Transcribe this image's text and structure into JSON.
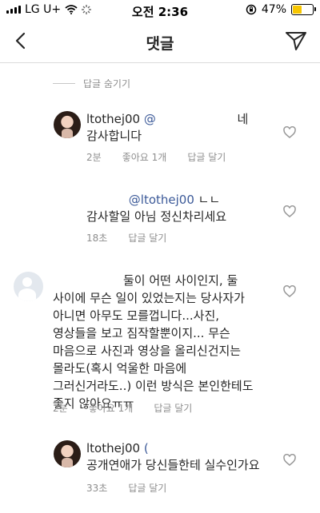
{
  "status": {
    "carrier": "LG U+",
    "time": "오전 2:36",
    "battery": "47%"
  },
  "header": {
    "title": "댓글"
  },
  "hide_replies_label": "답글 숨기기",
  "comments": [
    {
      "username": "ltothej00",
      "mention": "@",
      "trailing": "네",
      "line2": "감사합니다",
      "time": "2분",
      "likes": "좋아요 1개",
      "reply": "답글 달기"
    },
    {
      "mention": "@ltothej00",
      "trailing": "ㄴㄴ",
      "line2": "감사할일 아님 정신차리세요",
      "time": "18초",
      "reply": "답글 달기"
    },
    {
      "lines": [
        "둘이 어떤 사이인지, 둘",
        "사이에 무슨 일이 있었는지는 당사자가",
        "아니면 아무도 모를껍니다...사진,",
        "영상들을 보고 짐작할뿐이지... 무슨",
        "마음으로 사진과 영상을 올리신건지는",
        "몰라도(혹시 억울한 마음에",
        "그러신거라도..) 이런 방식은 본인한테도",
        "좋지 않아요ㅠㅠ"
      ],
      "time": "2분",
      "likes": "좋아요 1개",
      "reply": "답글 달기"
    },
    {
      "username": "ltothej00",
      "mention": "(",
      "line2": "공개연애가 당신들한테 실수인가요",
      "time": "33초",
      "reply": "답글 달기"
    }
  ]
}
